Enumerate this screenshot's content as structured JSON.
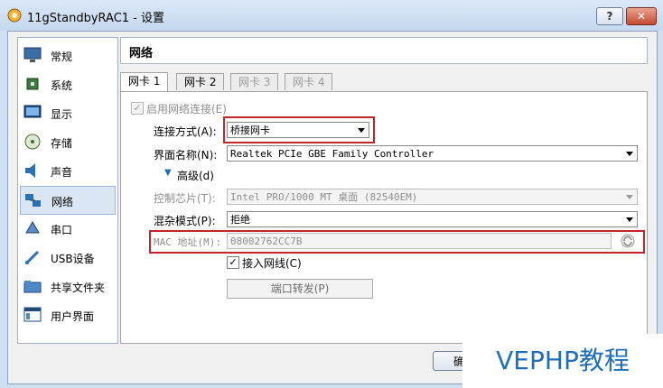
{
  "window": {
    "title": "11gStandbyRAC1 - 设置",
    "help": "?",
    "close": "✕"
  },
  "sidebar": {
    "items": [
      {
        "label": "常规"
      },
      {
        "label": "系统"
      },
      {
        "label": "显示"
      },
      {
        "label": "存储"
      },
      {
        "label": "声音"
      },
      {
        "label": "网络"
      },
      {
        "label": "串口"
      },
      {
        "label": "USB设备"
      },
      {
        "label": "共享文件夹"
      },
      {
        "label": "用户界面"
      }
    ],
    "active_index": 5
  },
  "header": {
    "title": "网络"
  },
  "tabs": [
    {
      "label": "网卡 1",
      "state": "active"
    },
    {
      "label": "网卡 2",
      "state": "normal"
    },
    {
      "label": "网卡 3",
      "state": "disabled"
    },
    {
      "label": "网卡 4",
      "state": "disabled"
    }
  ],
  "form": {
    "enable_label": "启用网络连接(E)",
    "attach_label": "连接方式(A):",
    "attach_value": "桥接网卡",
    "name_label": "界面名称(N):",
    "name_value": "Realtek PCIe GBE Family Controller",
    "advanced_label": "高级(d)",
    "chip_label": "控制芯片(T):",
    "chip_value": "Intel PRO/1000 MT 桌面 (82540EM)",
    "promisc_label": "混杂模式(P):",
    "promisc_value": "拒绝",
    "mac_label": "MAC 地址(M):",
    "mac_value": "08002762CC7B",
    "cable_label": "接入网线(C)",
    "port_forward_label": "端口转发(P)"
  },
  "footer": {
    "ok_partial": "确"
  },
  "watermark": {
    "text": "VEPHP教程"
  },
  "colors": {
    "highlight_box": "#c0262c",
    "accent": "#1f6fb6"
  }
}
